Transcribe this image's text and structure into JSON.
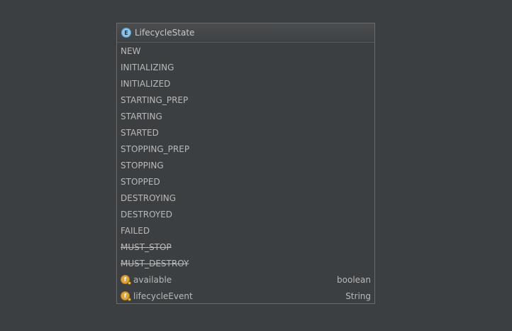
{
  "popup": {
    "title": "LifecycleState",
    "title_icon_letter": "E",
    "enum_constants": [
      {
        "label": "NEW",
        "deprecated": false
      },
      {
        "label": "INITIALIZING",
        "deprecated": false
      },
      {
        "label": "INITIALIZED",
        "deprecated": false
      },
      {
        "label": "STARTING_PREP",
        "deprecated": false
      },
      {
        "label": "STARTING",
        "deprecated": false
      },
      {
        "label": "STARTED",
        "deprecated": false
      },
      {
        "label": "STOPPING_PREP",
        "deprecated": false
      },
      {
        "label": "STOPPING",
        "deprecated": false
      },
      {
        "label": "STOPPED",
        "deprecated": false
      },
      {
        "label": "DESTROYING",
        "deprecated": false
      },
      {
        "label": "DESTROYED",
        "deprecated": false
      },
      {
        "label": "FAILED",
        "deprecated": false
      },
      {
        "label": "MUST_STOP",
        "deprecated": true
      },
      {
        "label": "MUST_DESTROY",
        "deprecated": true
      }
    ],
    "fields": [
      {
        "label": "available",
        "type": "boolean",
        "icon": "field-icon"
      },
      {
        "label": "lifecycleEvent",
        "type": "String",
        "icon": "field-icon"
      }
    ]
  },
  "colors": {
    "background": "#3c3f41",
    "text": "#b9b9b9",
    "enum_icon": "#8cc3e8",
    "field_icon": "#e0a33a"
  }
}
